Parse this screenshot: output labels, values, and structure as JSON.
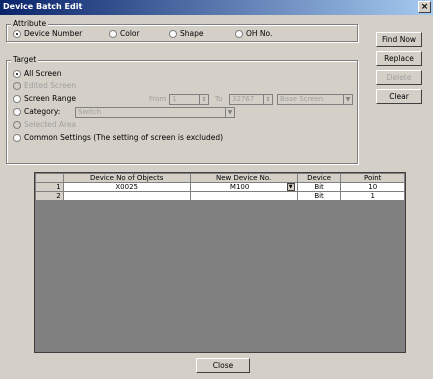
{
  "window": {
    "title": "Device Batch Edit",
    "close_glyph": "×"
  },
  "attribute": {
    "legend": "Attribute",
    "options": [
      "Device Number",
      "Color",
      "Shape",
      "OH No."
    ],
    "selected": "Device Number"
  },
  "target": {
    "legend": "Target",
    "all_screen": "All Screen",
    "edited_screen": "Edited Screen",
    "screen_range": "Screen Range",
    "from_label": "From",
    "from_value": "1",
    "to_label": "To",
    "to_value": "32767",
    "base_screen": "Base Screen",
    "category": "Category:",
    "category_value": "Switch",
    "selected_area": "Selected Area",
    "common_settings": "Common Settings (The setting of screen is excluded)"
  },
  "buttons": {
    "find_now": "Find Now",
    "replace": "Replace",
    "delete": "Delete",
    "clear": "Clear",
    "close": "Close"
  },
  "table": {
    "headers": [
      "",
      "Device No of Objects",
      "New Device No.",
      "Device",
      "Point"
    ],
    "rows": [
      {
        "num": "1",
        "device_no": "X0025",
        "new_device_no": "M100",
        "device": "Bit",
        "point": "10"
      },
      {
        "num": "2",
        "device_no": "",
        "new_device_no": "",
        "device": "Bit",
        "point": "1"
      }
    ]
  }
}
